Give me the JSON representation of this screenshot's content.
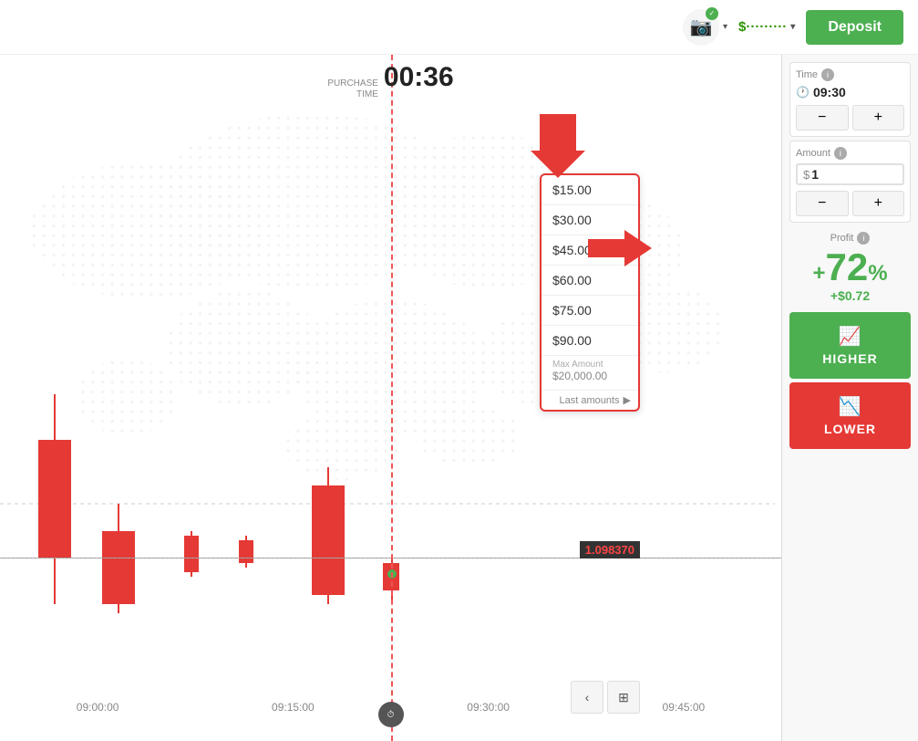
{
  "header": {
    "balance": "$·········",
    "deposit_label": "Deposit"
  },
  "chart": {
    "purchase_time_label": "PURCHASE\nTIME",
    "purchase_time_value": "00:36",
    "price": "1.0983",
    "price_highlight": "70",
    "x_labels": [
      "09:00:00",
      "09:15:00",
      "09:30:00",
      "09:45:00"
    ]
  },
  "amount_dropdown": {
    "items": [
      "$15.00",
      "$30.00",
      "$45.00",
      "$60.00",
      "$75.00",
      "$90.00"
    ],
    "max_label": "Max Amount",
    "max_value": "$20,000.00",
    "last_amounts_label": "Last amounts"
  },
  "right_panel": {
    "time_label": "Time",
    "time_value": "09:30",
    "minus_label": "−",
    "plus_label": "+",
    "amount_label": "Amount",
    "amount_currency": "$",
    "amount_value": "1",
    "profit_label": "Profit",
    "profit_percent": "+72",
    "profit_percent_sign": "%",
    "profit_dollar": "+$0.72",
    "higher_label": "HIGHER",
    "lower_label": "LOWER"
  }
}
